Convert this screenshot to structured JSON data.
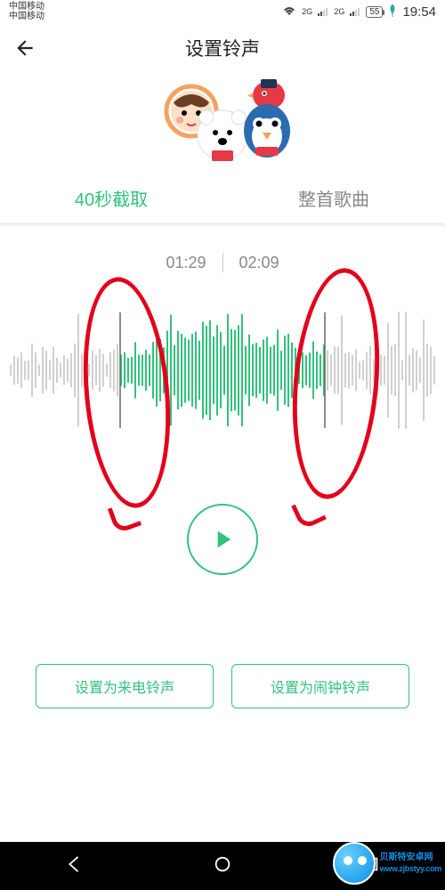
{
  "status": {
    "carrier": "中国移动\n中国移动",
    "sig": "2G",
    "battery": "55",
    "time": "19:54"
  },
  "header": {
    "title": "设置铃声"
  },
  "tabs": {
    "clip_label": "40秒截取",
    "full_label": "整首歌曲"
  },
  "clip": {
    "start_time": "01:29",
    "end_time": "02:09"
  },
  "buttons": {
    "set_call": "设置为来电铃声",
    "set_alarm": "设置为闹钟铃声"
  },
  "watermark": {
    "name": "贝斯特安卓网",
    "url": "www.zjbstyy.com"
  },
  "colors": {
    "accent": "#31c27c",
    "annotation": "#e3001b"
  }
}
